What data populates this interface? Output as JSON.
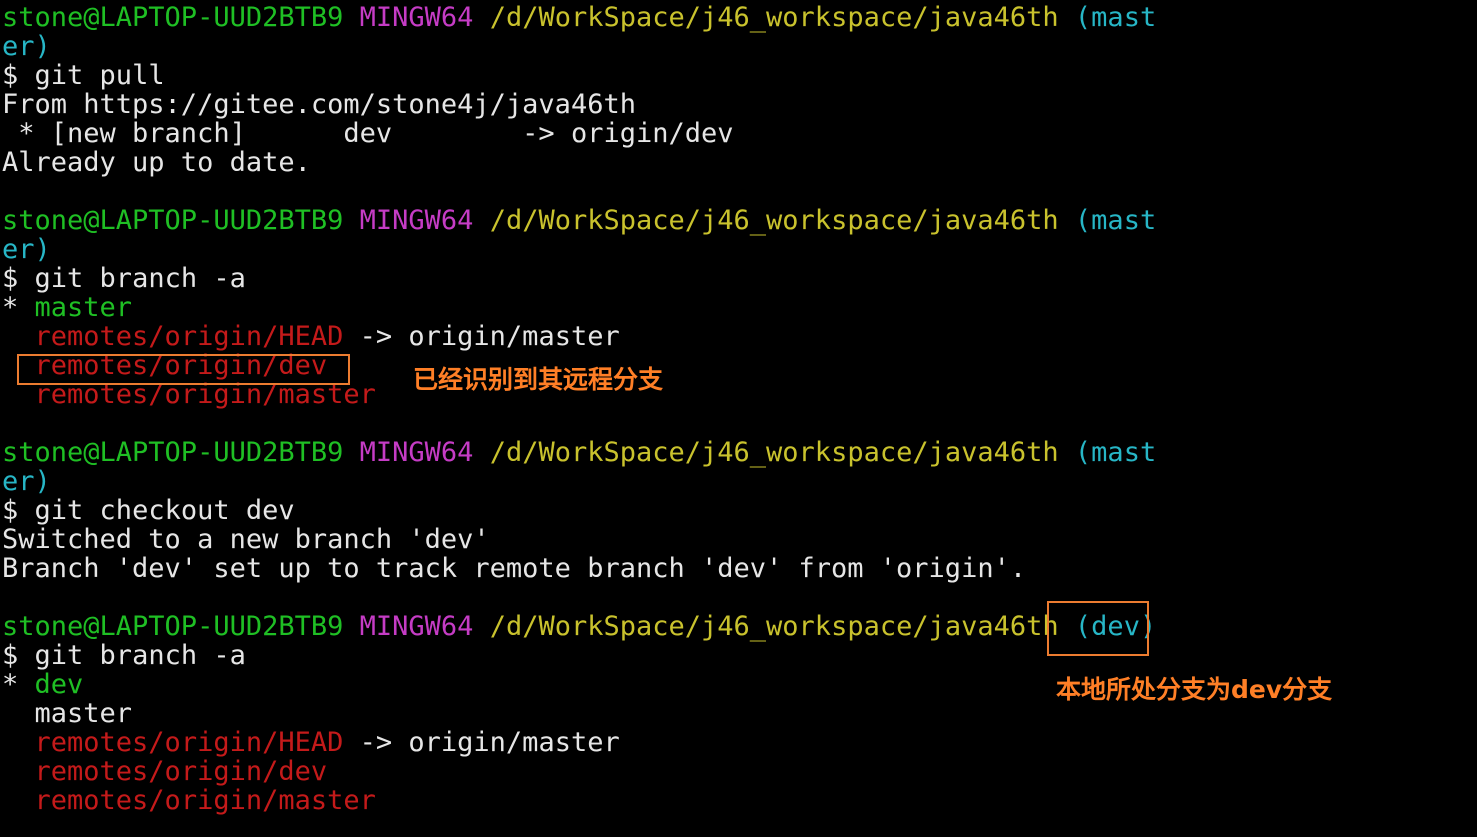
{
  "colors": {
    "background": "#000000",
    "user_host": "#1fbf24",
    "msystem": "#c53cc5",
    "path": "#c9c22d",
    "branch": "#27b6c6",
    "remote_branch": "#c41a1a",
    "annotation": "#ff7f26"
  },
  "prompt": {
    "user_host": "stone@LAPTOP-UUD2BTB9",
    "msystem": "MINGW64",
    "path": "/d/WorkSpace/j46_workspace/java46th",
    "branch_master_part1": "(mast",
    "branch_master_part2": "er)",
    "branch_dev": "(dev)",
    "dollar": "$"
  },
  "block1": {
    "command": "git pull",
    "output": [
      "From https://gitee.com/stone4j/java46th",
      " * [new branch]      dev        -> origin/dev",
      "Already up to date."
    ]
  },
  "block2": {
    "command": "git branch -a",
    "current_marker": "*",
    "current_branch": "master",
    "remote_head": "remotes/origin/HEAD",
    "remote_head_target": " -> origin/master",
    "remote_dev": "remotes/origin/dev",
    "remote_master": "remotes/origin/master"
  },
  "block3": {
    "command": "git checkout dev",
    "output": [
      "Switched to a new branch 'dev'",
      "Branch 'dev' set up to track remote branch 'dev' from 'origin'."
    ]
  },
  "block4": {
    "command": "git branch -a",
    "current_marker": "*",
    "current_branch": "dev",
    "other_branch": "master",
    "remote_head": "remotes/origin/HEAD",
    "remote_head_target": " -> origin/master",
    "remote_dev": "remotes/origin/dev",
    "remote_master": "remotes/origin/master"
  },
  "annotations": {
    "remote_recognized": "已经识别到其远程分支",
    "local_branch_is_dev": "本地所处分支为dev分支"
  }
}
